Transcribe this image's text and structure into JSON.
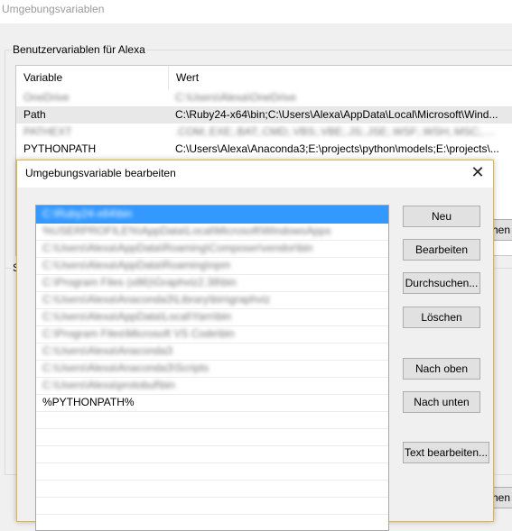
{
  "background_window": {
    "title": "Umgebungsvariablen",
    "user_group_label": "Benutzervariablen für Alexa",
    "system_group_label_visible": "S",
    "user_table": {
      "columns": [
        "Variable",
        "Wert"
      ],
      "rows": [
        {
          "variable": "OneDrive",
          "value": "C:\\Users\\Alexa\\OneDrive",
          "blurred": true
        },
        {
          "variable": "Path",
          "value": "C:\\Ruby24-x64\\bin;C:\\Users\\Alexa\\AppData\\Local\\Microsoft\\Wind...",
          "blurred": false,
          "selected": true
        },
        {
          "variable": "PATHEXT",
          "value": ".COM;.EXE;.BAT;.CMD;.VBS;.VBE;.JS;.JSE;.WSF;.WSH;.MSC;.PY;.PYW;.RB;.RBW",
          "blurred": true
        },
        {
          "variable": "PYTHONPATH",
          "value": "C:\\Users\\Alexa\\Anaconda3;E:\\projects\\python\\models;E:\\projects\\...",
          "blurred": false
        }
      ]
    },
    "edge_buttons": [
      "hen",
      "hen"
    ]
  },
  "dialog": {
    "title": "Umgebungsvariable bearbeiten",
    "close_glyph": "✕",
    "path_entries": [
      {
        "text": "C:\\Ruby24-x64\\bin",
        "blurred": true,
        "selected": true
      },
      {
        "text": "%USERPROFILE%\\AppData\\Local\\Microsoft\\WindowsApps",
        "blurred": true
      },
      {
        "text": "C:\\Users\\Alexa\\AppData\\Roaming\\Composer\\vendor\\bin",
        "blurred": true
      },
      {
        "text": "C:\\Users\\Alexa\\AppData\\Roaming\\npm",
        "blurred": true
      },
      {
        "text": "C:\\Program Files (x86)\\Graphviz2.38\\bin",
        "blurred": true
      },
      {
        "text": "C:\\Users\\Alexa\\Anaconda3\\Library\\bin\\graphviz",
        "blurred": true
      },
      {
        "text": "C:\\Users\\Alexa\\AppData\\Local\\Yarn\\bin",
        "blurred": true
      },
      {
        "text": "C:\\Program Files\\Microsoft VS Code\\bin",
        "blurred": true
      },
      {
        "text": "C:\\Users\\Alexa\\Anaconda3",
        "blurred": true
      },
      {
        "text": "C:\\Users\\Alexa\\Anaconda3\\Scripts",
        "blurred": true
      },
      {
        "text": "C:\\Users\\Alexa\\protobuf\\bin",
        "blurred": true
      },
      {
        "text": "%PYTHONPATH%",
        "blurred": false
      },
      {
        "text": "",
        "blurred": false
      },
      {
        "text": "",
        "blurred": false
      },
      {
        "text": "",
        "blurred": false
      },
      {
        "text": "",
        "blurred": false
      },
      {
        "text": "",
        "blurred": false
      },
      {
        "text": "",
        "blurred": false
      }
    ],
    "buttons": {
      "new": "Neu",
      "edit": "Bearbeiten",
      "browse": "Durchsuchen...",
      "delete": "Löschen",
      "move_up": "Nach oben",
      "move_down": "Nach unten",
      "edit_text": "Text bearbeiten..."
    }
  },
  "colors": {
    "selection": "#3399ff",
    "dialog_border": "#e3b53a",
    "button_face": "#e1e1e1",
    "window_bg": "#f0f0f0"
  }
}
